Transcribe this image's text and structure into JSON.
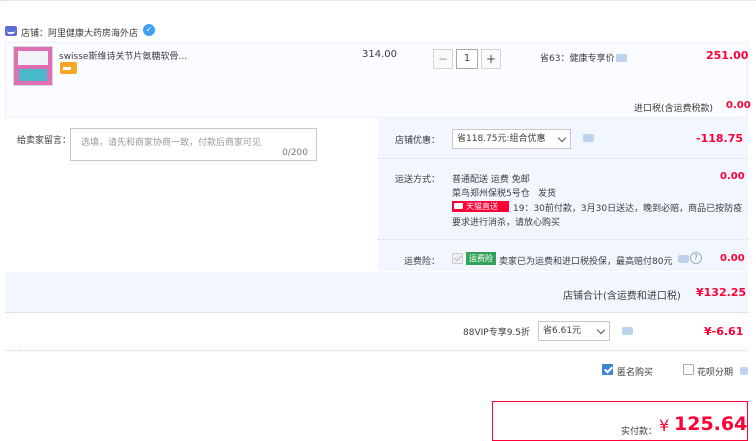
{
  "shop": {
    "name": "店铺：阿里健康大药房海外店",
    "wangwang_icon": "chat-bubble-icon"
  },
  "item": {
    "title": "swisse斯维诗关节片氨糖软骨...",
    "unit_price": "314.00",
    "quantity": "1",
    "minus_label": "−",
    "plus_label": "+",
    "promo": "省63：健康专享价",
    "total": "251.00",
    "tax_label": "进口税(含运费税款)",
    "tax_value": "0.00"
  },
  "message": {
    "label": "给卖家留言：",
    "placeholder": "选填，请先和商家协商一致，付款后商家可见",
    "count": "0/200"
  },
  "discount": {
    "label": "店铺优惠：",
    "selected": "省118.75元:组合优惠",
    "value": "-118.75"
  },
  "shipping": {
    "label": "运送方式：",
    "method": "普通配送 运费 免邮",
    "warehouse": "菜鸟郑州保税5号仓",
    "ship_text": "发货",
    "badge": "天猫直送",
    "promise": "19：30前付款，3月30日送达，晚到必赔，商品已按防疫",
    "promise2": "要求进行消杀，请放心购买",
    "value": "0.00"
  },
  "insurance": {
    "label": "运费险：",
    "badge": "运费险",
    "text": "卖家已为运费和进口税投保，最高赔付80元",
    "help": "?",
    "value": "0.00"
  },
  "subtotal": {
    "label": "店铺合计(含运费和进口税)",
    "value": "¥132.25"
  },
  "vip": {
    "label": "88VIP专享9.5折",
    "selected": "省6.61元",
    "value": "¥-6.61"
  },
  "options": {
    "anonymous": "匿名购买",
    "anonymous_checked": true,
    "huabei": "花呗分期",
    "huabei_checked": false
  },
  "pay": {
    "label": "实付款：",
    "currency": "¥",
    "amount": "125.64"
  },
  "colors": {
    "accent_red": "#ff0036",
    "panel_blue": "#f2f7ff",
    "checkbox_blue": "#3d84d6"
  }
}
